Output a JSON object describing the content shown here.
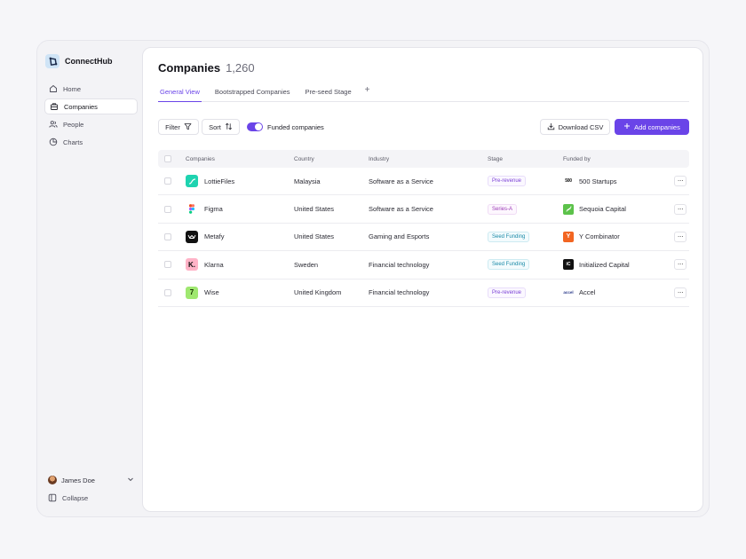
{
  "app": {
    "name": "ConnectHub"
  },
  "sidebar": {
    "items": [
      {
        "label": "Home",
        "icon": "home-icon",
        "active": false
      },
      {
        "label": "Companies",
        "icon": "building-icon",
        "active": true
      },
      {
        "label": "People",
        "icon": "people-icon",
        "active": false
      },
      {
        "label": "Charts",
        "icon": "pie-chart-icon",
        "active": false
      }
    ],
    "user": {
      "name": "James Doe"
    },
    "collapse_label": "Collapse"
  },
  "header": {
    "title": "Companies",
    "count": "1,260"
  },
  "tabs": [
    {
      "label": "General View",
      "active": true
    },
    {
      "label": "Bootstrapped Companies",
      "active": false
    },
    {
      "label": "Pre-seed Stage",
      "active": false
    }
  ],
  "tab_add_label": "+",
  "toolbar": {
    "filter_label": "Filter",
    "sort_label": "Sort",
    "toggle_label": "Funded companies",
    "toggle_on": true,
    "download_label": "Download CSV",
    "add_label": "Add companies"
  },
  "table": {
    "columns": [
      "Companies",
      "Country",
      "Industry",
      "Stage",
      "Funded by"
    ],
    "rows": [
      {
        "company": "LottieFiles",
        "country": "Malaysia",
        "industry": "Software as a Service",
        "stage": "Pre-revenue",
        "funded_by": "500 Startups"
      },
      {
        "company": "Figma",
        "country": "United States",
        "industry": "Software as a Service",
        "stage": "Series-A",
        "funded_by": "Sequoia Capital"
      },
      {
        "company": "Metafy",
        "country": "United States",
        "industry": "Gaming and Esports",
        "stage": "Seed Funding",
        "funded_by": "Y Combinator"
      },
      {
        "company": "Klarna",
        "country": "Sweden",
        "industry": "Financial technology",
        "stage": "Seed Funding",
        "funded_by": "Initialized Capital"
      },
      {
        "company": "Wise",
        "country": "United Kingdom",
        "industry": "Financial technology",
        "stage": "Pre-revenue",
        "funded_by": "Accel"
      }
    ],
    "logo_text": {
      "klarna": "K.",
      "wise": "7",
      "ycomb": "Y",
      "initialized": "iC",
      "startups": "500",
      "accel": "accel"
    }
  },
  "colors": {
    "accent": "#6a44e8",
    "lottie": "#1ed3b0",
    "metafy": "#111111",
    "klarna": "#ffb3c7",
    "wise": "#9fe870",
    "sequoia": "#5cc24a",
    "ycomb": "#f26522"
  }
}
